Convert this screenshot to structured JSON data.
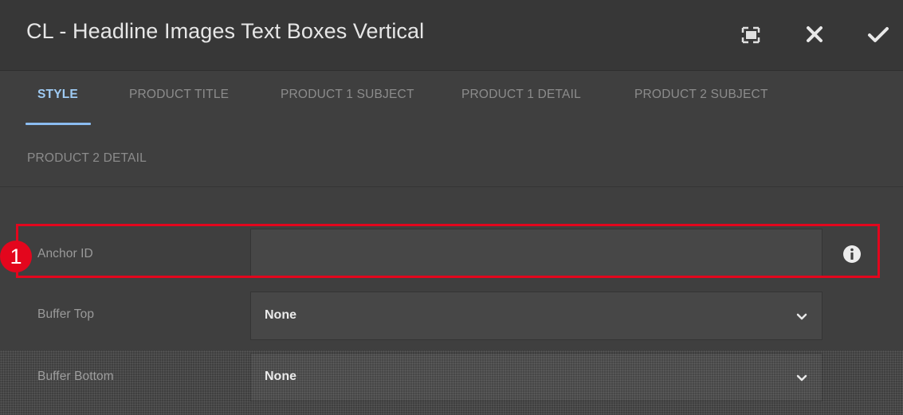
{
  "dialog": {
    "title": "CL - Headline Images Text Boxes Vertical",
    "header_icons": [
      "fullscreen-icon",
      "close-icon",
      "check-icon"
    ]
  },
  "tabs": [
    {
      "label": "STYLE",
      "active": true
    },
    {
      "label": "PRODUCT TITLE",
      "active": false
    },
    {
      "label": "PRODUCT 1 SUBJECT",
      "active": false
    },
    {
      "label": "PRODUCT 1 DETAIL",
      "active": false
    },
    {
      "label": "PRODUCT 2 SUBJECT",
      "active": false
    },
    {
      "label": "PRODUCT 2 DETAIL",
      "active": false
    }
  ],
  "fields": {
    "anchor_id": {
      "label": "Anchor ID",
      "value": "",
      "icon": "info-icon"
    },
    "buffer_top": {
      "label": "Buffer Top",
      "value": "None",
      "icon": "chevron-down-icon"
    },
    "buffer_bottom": {
      "label": "Buffer Bottom",
      "value": "None",
      "icon": "chevron-down-icon"
    }
  },
  "annotation": {
    "marker_number": "1",
    "color": "#e3061d"
  },
  "colors": {
    "header_bg": "#373737",
    "panel_bg": "#3f3f3f",
    "active_tab": "#9fcbf4",
    "tab_indicator": "#8bbcf0"
  }
}
